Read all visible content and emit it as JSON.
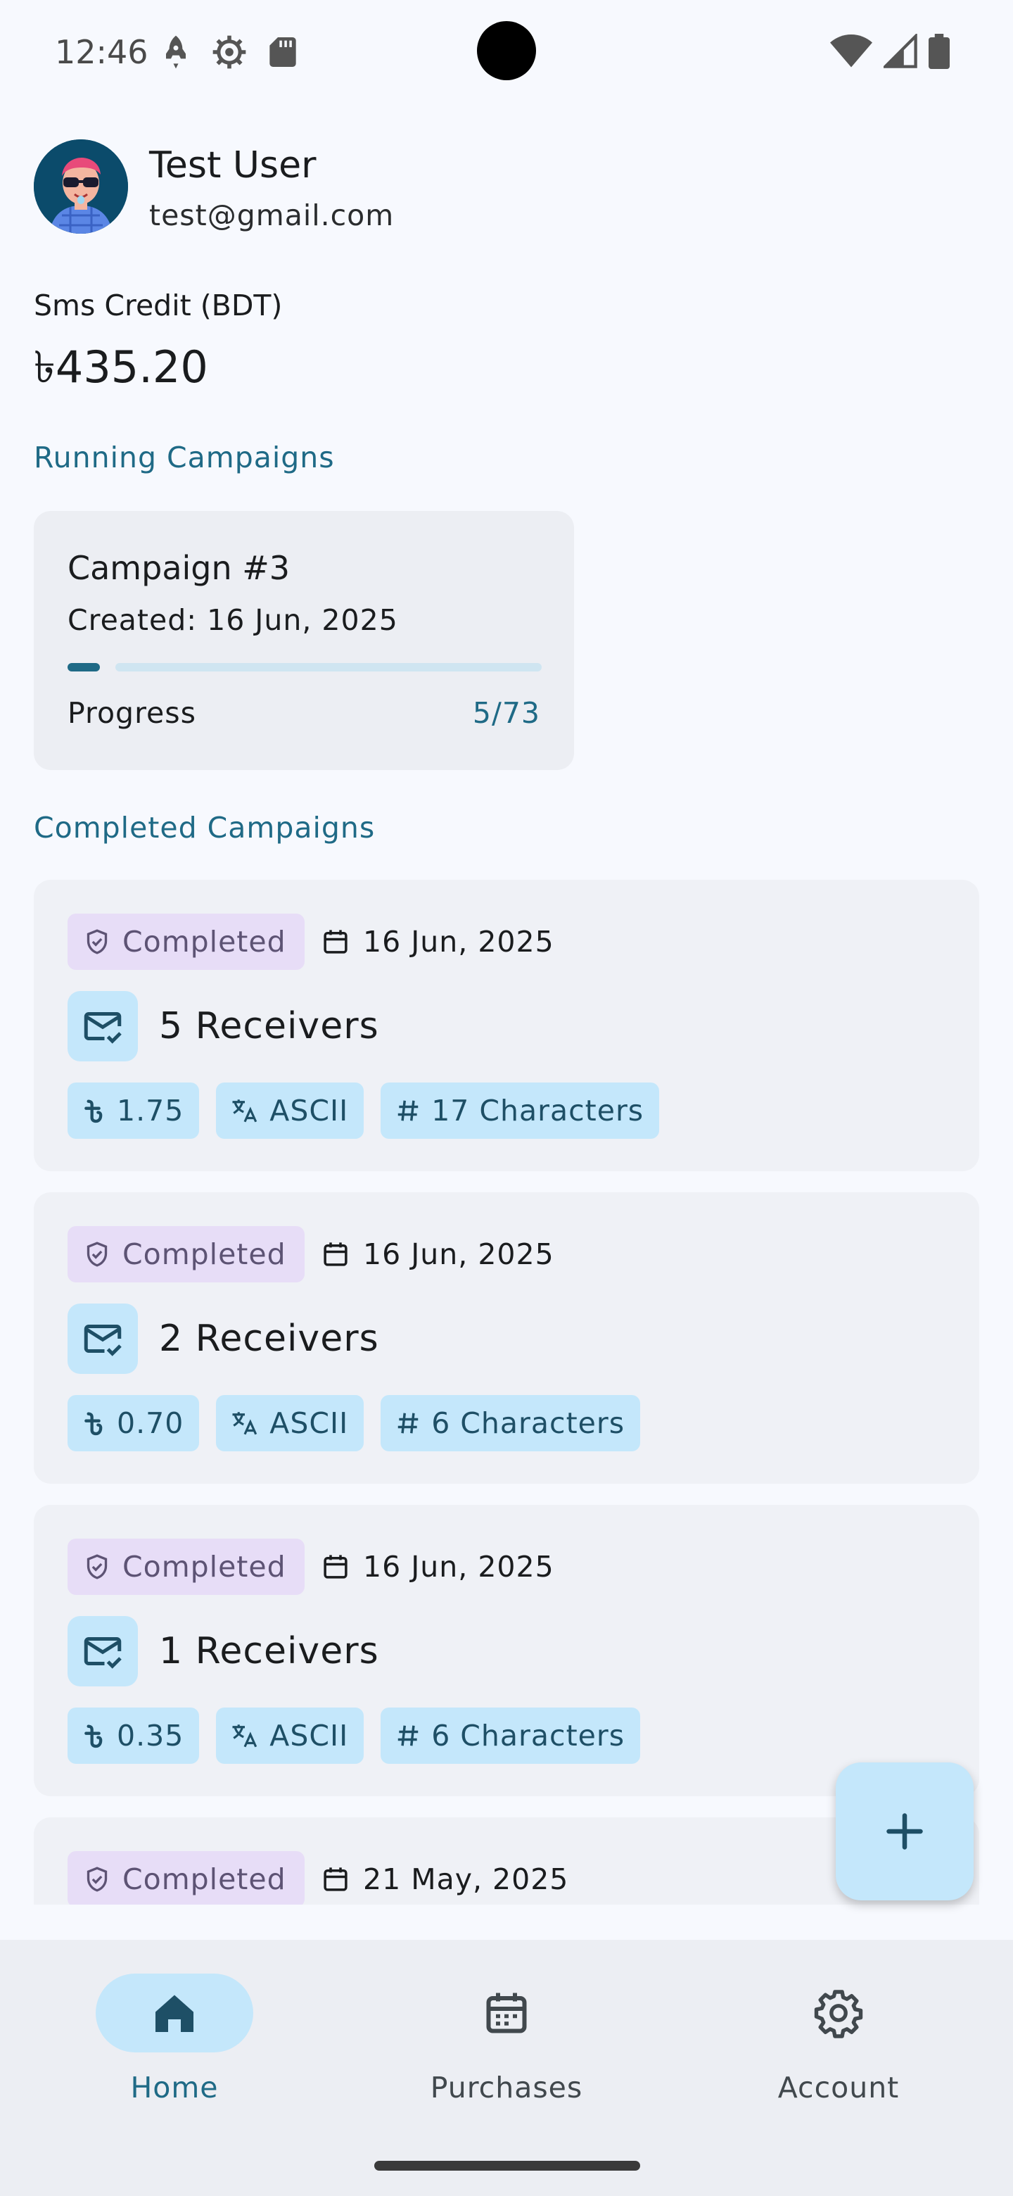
{
  "status_bar": {
    "time": "12:46",
    "icons": [
      "rocket-icon",
      "settings-icon",
      "sd-card-icon",
      "wifi-icon",
      "signal-icon",
      "battery-icon"
    ]
  },
  "user": {
    "name": "Test User",
    "email": "test@gmail.com"
  },
  "credit": {
    "label": "Sms Credit (BDT)",
    "value": "৳435.20"
  },
  "running": {
    "title": "Running Campaigns",
    "campaigns": [
      {
        "name": "Campaign #3",
        "created": "Created: 16 Jun, 2025",
        "progress_label": "Progress",
        "progress_text": "5/73",
        "sent": 5,
        "total": 73
      }
    ]
  },
  "completed": {
    "title": "Completed Campaigns",
    "campaigns": [
      {
        "status": "Completed",
        "date": "16 Jun, 2025",
        "receivers": "5 Receivers",
        "cost": "1.75",
        "encoding": "ASCII",
        "characters": "17 Characters"
      },
      {
        "status": "Completed",
        "date": "16 Jun, 2025",
        "receivers": "2 Receivers",
        "cost": "0.70",
        "encoding": "ASCII",
        "characters": "6 Characters"
      },
      {
        "status": "Completed",
        "date": "16 Jun, 2025",
        "receivers": "1 Receivers",
        "cost": "0.35",
        "encoding": "ASCII",
        "characters": "6 Characters"
      },
      {
        "status": "Completed",
        "date": "21 May, 2025"
      }
    ]
  },
  "fab": {
    "icon": "plus-icon"
  },
  "nav": {
    "items": [
      {
        "label": "Home",
        "icon": "home-icon",
        "active": true
      },
      {
        "label": "Purchases",
        "icon": "calendar-icon",
        "active": false
      },
      {
        "label": "Account",
        "icon": "gear-icon",
        "active": false
      }
    ]
  },
  "colors": {
    "primary": "#1f6a86",
    "chip_bg": "#c4e7fb",
    "badge_bg": "#e7ddf7",
    "background": "#f7f9fe"
  }
}
